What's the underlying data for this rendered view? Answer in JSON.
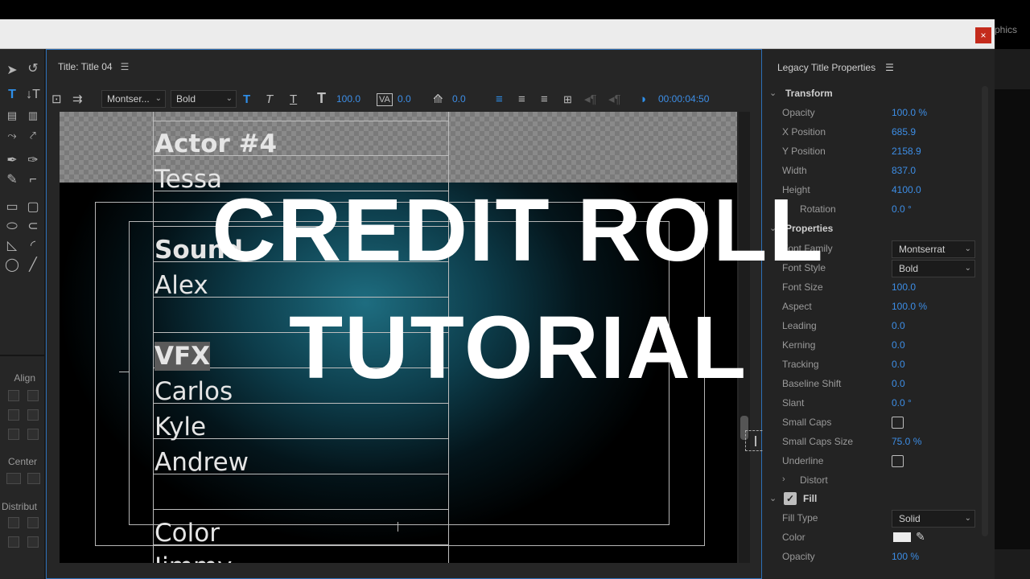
{
  "window": {
    "tab_partial": "phics",
    "close_label": "×"
  },
  "tools": {
    "align_label": "Align",
    "center_label": "Center",
    "distribute_label": "Distribut"
  },
  "editor": {
    "tab_title": "Title: Title 04",
    "font_family": "Montser...",
    "font_style": "Bold",
    "font_size": "100.0",
    "kerning": "0.0",
    "leading": "0.0",
    "timecode": "00:00:04:50"
  },
  "credits": [
    {
      "text": "Actor #4",
      "bold": true
    },
    {
      "text": "Tessa",
      "bold": false
    },
    {
      "text": "Sound",
      "bold": true
    },
    {
      "text": "Alex",
      "bold": false
    },
    {
      "text": "VFX",
      "bold": true
    },
    {
      "text": "Carlos",
      "bold": false
    },
    {
      "text": "Kyle",
      "bold": false
    },
    {
      "text": "Andrew",
      "bold": false
    },
    {
      "text": "Color",
      "bold": false
    },
    {
      "text": "Jimmy",
      "bold": false
    }
  ],
  "properties": {
    "header": "Legacy Title Properties",
    "transform_label": "Transform",
    "properties_label": "Properties",
    "distort_label": "Distort",
    "fill_label": "Fill",
    "rows": {
      "opacity": {
        "label": "Opacity",
        "value": "100.0 %"
      },
      "x_position": {
        "label": "X Position",
        "value": "685.9"
      },
      "y_position": {
        "label": "Y Position",
        "value": "2158.9"
      },
      "width": {
        "label": "Width",
        "value": "837.0"
      },
      "height": {
        "label": "Height",
        "value": "4100.0"
      },
      "rotation": {
        "label": "Rotation",
        "value": "0.0 °"
      },
      "font_family": {
        "label": "Font Family",
        "value": "Montserrat"
      },
      "font_style": {
        "label": "Font Style",
        "value": "Bold"
      },
      "font_size": {
        "label": "Font Size",
        "value": "100.0"
      },
      "aspect": {
        "label": "Aspect",
        "value": "100.0 %"
      },
      "leading": {
        "label": "Leading",
        "value": "0.0"
      },
      "kerning": {
        "label": "Kerning",
        "value": "0.0"
      },
      "tracking": {
        "label": "Tracking",
        "value": "0.0"
      },
      "baseline_shift": {
        "label": "Baseline Shift",
        "value": "0.0"
      },
      "slant": {
        "label": "Slant",
        "value": "0.0 °"
      },
      "small_caps": {
        "label": "Small Caps",
        "checked": false
      },
      "small_caps_size": {
        "label": "Small Caps Size",
        "value": "75.0 %"
      },
      "underline": {
        "label": "Underline",
        "checked": false
      },
      "fill_type": {
        "label": "Fill Type",
        "value": "Solid"
      },
      "color": {
        "label": "Color",
        "value": "#ededed"
      },
      "fill_opacity": {
        "label": "Opacity",
        "value": "100 %"
      }
    }
  },
  "overlay": {
    "line1": "CREDIT ROLL",
    "line2": "TUTORIAL"
  },
  "colors": {
    "accent": "#3d8ee6",
    "close": "#c42b1c",
    "glow": "#1e6d80"
  }
}
